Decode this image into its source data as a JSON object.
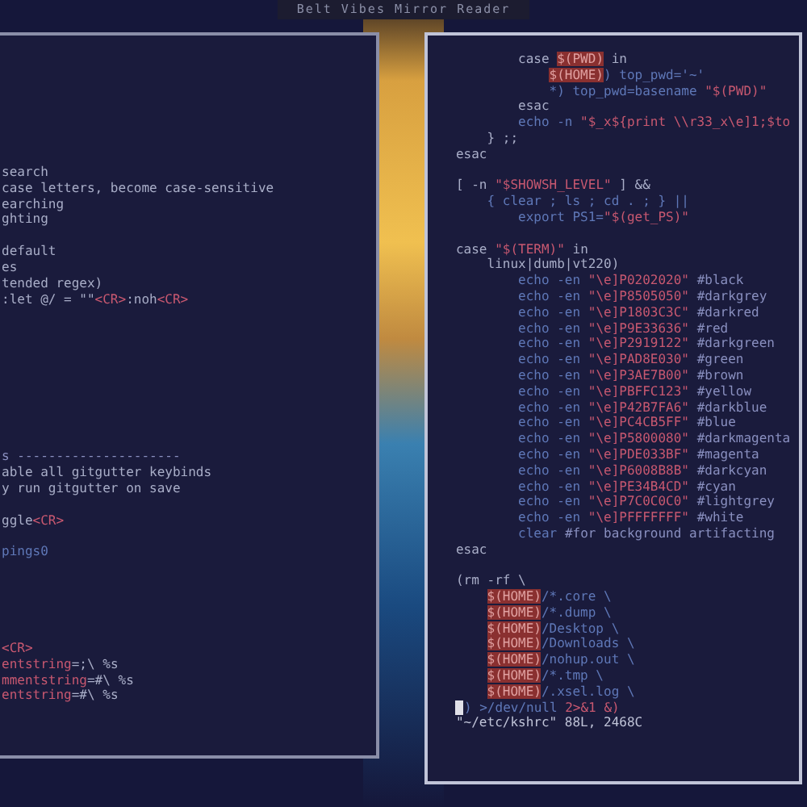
{
  "title_bar": {
    "title": "Belt Vibes  Mirror Reader"
  },
  "left_pane": {
    "blocks": [
      [
        {
          "segments": [
            {
              "text": "search",
              "kind": "plain"
            }
          ]
        },
        {
          "segments": [
            {
              "text": "case letters, become case-sensitive",
              "kind": "plain"
            }
          ]
        },
        {
          "segments": [
            {
              "text": "earching",
              "kind": "plain"
            }
          ]
        },
        {
          "segments": [
            {
              "text": "ghting",
              "kind": "plain"
            }
          ]
        }
      ],
      [
        {
          "segments": [
            {
              "text": "default",
              "kind": "plain"
            }
          ]
        },
        {
          "segments": [
            {
              "text": "es",
              "kind": "plain"
            }
          ]
        },
        {
          "segments": [
            {
              "text": "tended regex)",
              "kind": "plain"
            }
          ]
        },
        {
          "segments": [
            {
              "text": ":let @/ = \"\"",
              "kind": "plain"
            },
            {
              "text": "<CR>",
              "kind": "string"
            },
            {
              "text": ":noh",
              "kind": "plain"
            },
            {
              "text": "<CR>",
              "kind": "string"
            }
          ]
        }
      ],
      [
        {
          "segments": [
            {
              "text": "s ---------------------",
              "kind": "comment"
            }
          ]
        },
        {
          "segments": [
            {
              "text": "able all gitgutter keybinds",
              "kind": "plain"
            }
          ]
        },
        {
          "segments": [
            {
              "text": "y run gitgutter on save",
              "kind": "plain"
            }
          ]
        },
        {
          "segments": [
            {
              "text": "ggle",
              "kind": "plain"
            },
            {
              "text": "<CR>",
              "kind": "string"
            }
          ],
          "blank_before": true
        },
        {
          "segments": [
            {
              "text": "pings0",
              "kind": "command"
            }
          ],
          "blank_before": true
        }
      ],
      [
        {
          "segments": [
            {
              "text": "<CR>",
              "kind": "string"
            }
          ]
        },
        {
          "segments": [
            {
              "text": "entstring",
              "kind": "string"
            },
            {
              "text": "=;\\ %s",
              "kind": "plain"
            }
          ]
        },
        {
          "segments": [
            {
              "text": "mmentstring",
              "kind": "string"
            },
            {
              "text": "=#\\ %s",
              "kind": "plain"
            }
          ]
        },
        {
          "segments": [
            {
              "text": "entstring",
              "kind": "string"
            },
            {
              "text": "=#\\ %s",
              "kind": "plain"
            }
          ]
        }
      ]
    ]
  },
  "right_pane": {
    "lines": [
      {
        "segments": [
          {
            "text": "        case ",
            "kind": "plain"
          },
          {
            "text": "$(PWD)",
            "kind": "variable"
          },
          {
            "text": " in",
            "kind": "plain"
          }
        ]
      },
      {
        "segments": [
          {
            "text": "            $(HOME)",
            "kind": "variable"
          },
          {
            "text": ") top_pwd='~'",
            "kind": "command"
          }
        ]
      },
      {
        "segments": [
          {
            "text": "            *) top_pwd=basename ",
            "kind": "command"
          },
          {
            "text": "\"$(PWD)\"",
            "kind": "string"
          }
        ]
      },
      {
        "segments": [
          {
            "text": "        esac",
            "kind": "plain"
          }
        ]
      },
      {
        "segments": [
          {
            "text": "        echo -n ",
            "kind": "command"
          },
          {
            "text": "\"$_x${print \\\\r33_x\\e]1;$to",
            "kind": "string"
          }
        ]
      },
      {
        "segments": [
          {
            "text": "    } ;;",
            "kind": "plain"
          }
        ]
      },
      {
        "segments": [
          {
            "text": "esac",
            "kind": "plain"
          }
        ]
      },
      {
        "segments": [
          {
            "text": "[ -n ",
            "kind": "plain"
          },
          {
            "text": "\"$SHOWSH_LEVEL\"",
            "kind": "string"
          },
          {
            "text": " ] &&",
            "kind": "plain"
          }
        ],
        "blank_before": true
      },
      {
        "segments": [
          {
            "text": "    { clear ; ls ; cd . ; } ||",
            "kind": "command"
          }
        ]
      },
      {
        "segments": [
          {
            "text": "        export PS1=",
            "kind": "command"
          },
          {
            "text": "\"$(get_PS)\"",
            "kind": "string"
          }
        ]
      },
      {
        "segments": [
          {
            "text": "case ",
            "kind": "plain"
          },
          {
            "text": "\"$(TERM)\"",
            "kind": "string"
          },
          {
            "text": " in",
            "kind": "plain"
          }
        ],
        "blank_before": true
      },
      {
        "segments": [
          {
            "text": "    linux|dumb|vt220)",
            "kind": "plain"
          }
        ]
      },
      {
        "segments": [
          {
            "text": "        echo -en ",
            "kind": "command"
          },
          {
            "text": "\"\\e]P0202020\"",
            "kind": "string"
          },
          {
            "text": " #black",
            "kind": "comment"
          }
        ]
      },
      {
        "segments": [
          {
            "text": "        echo -en ",
            "kind": "command"
          },
          {
            "text": "\"\\e]P8505050\"",
            "kind": "string"
          },
          {
            "text": " #darkgrey",
            "kind": "comment"
          }
        ]
      },
      {
        "segments": [
          {
            "text": "        echo -en ",
            "kind": "command"
          },
          {
            "text": "\"\\e]P1803C3C\"",
            "kind": "string"
          },
          {
            "text": " #darkred",
            "kind": "comment"
          }
        ]
      },
      {
        "segments": [
          {
            "text": "        echo -en ",
            "kind": "command"
          },
          {
            "text": "\"\\e]P9E33636\"",
            "kind": "string"
          },
          {
            "text": " #red",
            "kind": "comment"
          }
        ]
      },
      {
        "segments": [
          {
            "text": "        echo -en ",
            "kind": "command"
          },
          {
            "text": "\"\\e]P2919122\"",
            "kind": "string"
          },
          {
            "text": " #darkgreen",
            "kind": "comment"
          }
        ]
      },
      {
        "segments": [
          {
            "text": "        echo -en ",
            "kind": "command"
          },
          {
            "text": "\"\\e]PAD8E030\"",
            "kind": "string"
          },
          {
            "text": " #green",
            "kind": "comment"
          }
        ]
      },
      {
        "segments": [
          {
            "text": "        echo -en ",
            "kind": "command"
          },
          {
            "text": "\"\\e]P3AE7B00\"",
            "kind": "string"
          },
          {
            "text": " #brown",
            "kind": "comment"
          }
        ]
      },
      {
        "segments": [
          {
            "text": "        echo -en ",
            "kind": "command"
          },
          {
            "text": "\"\\e]PBFFC123\"",
            "kind": "string"
          },
          {
            "text": " #yellow",
            "kind": "comment"
          }
        ]
      },
      {
        "segments": [
          {
            "text": "        echo -en ",
            "kind": "command"
          },
          {
            "text": "\"\\e]P42B7FA6\"",
            "kind": "string"
          },
          {
            "text": " #darkblue",
            "kind": "comment"
          }
        ]
      },
      {
        "segments": [
          {
            "text": "        echo -en ",
            "kind": "command"
          },
          {
            "text": "\"\\e]PC4CB5FF\"",
            "kind": "string"
          },
          {
            "text": " #blue",
            "kind": "comment"
          }
        ]
      },
      {
        "segments": [
          {
            "text": "        echo -en ",
            "kind": "command"
          },
          {
            "text": "\"\\e]P5800080\"",
            "kind": "string"
          },
          {
            "text": " #darkmagenta",
            "kind": "comment"
          }
        ]
      },
      {
        "segments": [
          {
            "text": "        echo -en ",
            "kind": "command"
          },
          {
            "text": "\"\\e]PDE033BF\"",
            "kind": "string"
          },
          {
            "text": " #magenta",
            "kind": "comment"
          }
        ]
      },
      {
        "segments": [
          {
            "text": "        echo -en ",
            "kind": "command"
          },
          {
            "text": "\"\\e]P6008B8B\"",
            "kind": "string"
          },
          {
            "text": " #darkcyan",
            "kind": "comment"
          }
        ]
      },
      {
        "segments": [
          {
            "text": "        echo -en ",
            "kind": "command"
          },
          {
            "text": "\"\\e]PE34B4CD\"",
            "kind": "string"
          },
          {
            "text": " #cyan",
            "kind": "comment"
          }
        ]
      },
      {
        "segments": [
          {
            "text": "        echo -en ",
            "kind": "command"
          },
          {
            "text": "\"\\e]P7C0C0C0\"",
            "kind": "string"
          },
          {
            "text": " #lightgrey",
            "kind": "comment"
          }
        ]
      },
      {
        "segments": [
          {
            "text": "        echo -en ",
            "kind": "command"
          },
          {
            "text": "\"\\e]PFFFFFFF\"",
            "kind": "string"
          },
          {
            "text": " #white",
            "kind": "comment"
          }
        ]
      },
      {
        "segments": [
          {
            "text": "        clear",
            "kind": "command"
          },
          {
            "text": " #for background artifacting",
            "kind": "comment"
          }
        ]
      },
      {
        "segments": [
          {
            "text": "esac",
            "kind": "plain"
          }
        ]
      },
      {
        "segments": [
          {
            "text": "(rm -rf \\",
            "kind": "plain"
          }
        ],
        "blank_before": true
      },
      {
        "segments": [
          {
            "text": "    $(HOME)",
            "kind": "variable"
          },
          {
            "text": "/*.core \\",
            "kind": "command"
          }
        ]
      },
      {
        "segments": [
          {
            "text": "    $(HOME)",
            "kind": "variable"
          },
          {
            "text": "/*.dump \\",
            "kind": "command"
          }
        ]
      },
      {
        "segments": [
          {
            "text": "    $(HOME)",
            "kind": "variable"
          },
          {
            "text": "/Desktop \\",
            "kind": "command"
          }
        ]
      },
      {
        "segments": [
          {
            "text": "    $(HOME)",
            "kind": "variable"
          },
          {
            "text": "/Downloads \\",
            "kind": "command"
          }
        ]
      },
      {
        "segments": [
          {
            "text": "    $(HOME)",
            "kind": "variable"
          },
          {
            "text": "/nohup.out \\",
            "kind": "command"
          }
        ]
      },
      {
        "segments": [
          {
            "text": "    $(HOME)",
            "kind": "variable"
          },
          {
            "text": "/*.tmp \\",
            "kind": "command"
          }
        ]
      },
      {
        "segments": [
          {
            "text": "    $(HOME)",
            "kind": "variable"
          },
          {
            "text": "/.xsel.log \\",
            "kind": "command"
          }
        ]
      },
      {
        "segments": [
          {
            "text": ") >/dev/null ",
            "kind": "command"
          },
          {
            "text": "2>&1 &)",
            "kind": "string"
          }
        ],
        "cursor": true
      }
    ],
    "status_line": "\"~/etc/kshrc\" 88L, 2468C"
  }
}
